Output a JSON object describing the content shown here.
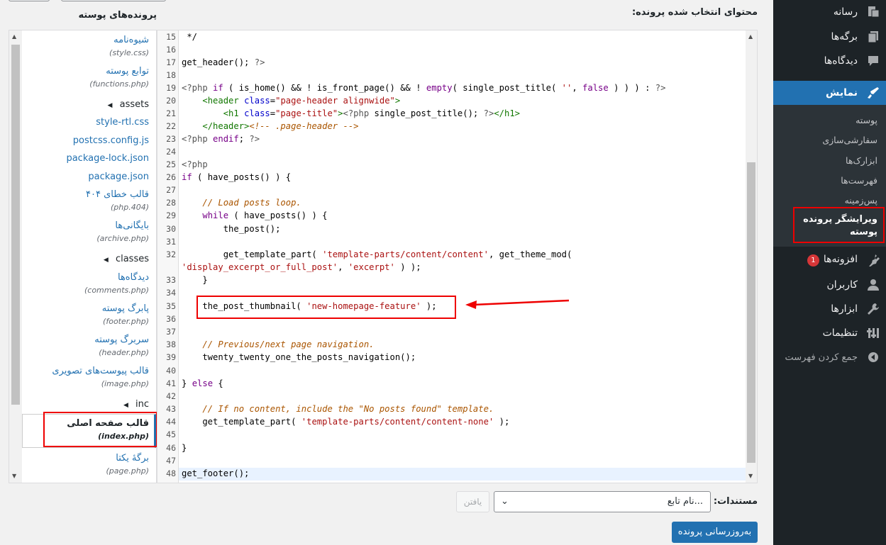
{
  "sidebar": {
    "items": [
      {
        "label": "رسانه",
        "icon": "media-icon"
      },
      {
        "label": "برگه‌ها",
        "icon": "pages-icon"
      },
      {
        "label": "دیدگاه‌ها",
        "icon": "comments-icon"
      },
      {
        "label": "نمایش",
        "icon": "appearance-icon"
      },
      {
        "label": "افزونه‌ها",
        "icon": "plugins-icon",
        "badge": "1"
      },
      {
        "label": "کاربران",
        "icon": "users-icon"
      },
      {
        "label": "ابزارها",
        "icon": "tools-icon"
      },
      {
        "label": "تنظیمات",
        "icon": "settings-icon"
      },
      {
        "label": "جمع کردن فهرست",
        "icon": "collapse-icon"
      }
    ],
    "submenu": [
      "پوسته",
      "سفارشی‌سازی",
      "ابزارک‌ها",
      "فهرست‌ها",
      "پس‌زمینه",
      "ویرایشگر پرونده پوسته"
    ]
  },
  "file_list": {
    "heading": "پرونده‌های پوسته",
    "entries": [
      {
        "name": "شیوه‌نامه",
        "path": "(style.css)"
      },
      {
        "name": "توابع پوسته",
        "path": "(functions.php)"
      },
      {
        "name": "assets"
      },
      {
        "name": "style-rtl.css"
      },
      {
        "name": "postcss.config.js"
      },
      {
        "name": "package-lock.json"
      },
      {
        "name": "package.json"
      },
      {
        "name": "قالب خطای ۴۰۴",
        "path": "(404.php)"
      },
      {
        "name": "بایگانی‌ها",
        "path": "(archive.php)"
      },
      {
        "name": "classes"
      },
      {
        "name": "دیدگاه‌ها",
        "path": "(comments.php)"
      },
      {
        "name": "پابرگ پوسته",
        "path": "(footer.php)"
      },
      {
        "name": "سربرگ پوسته",
        "path": "(header.php)"
      },
      {
        "name": "قالب پیوست‌های تصویری",
        "path": "(image.php)"
      },
      {
        "name": "inc"
      },
      {
        "name": "قالب صفحه اصلی",
        "path": "(index.php)"
      },
      {
        "name": "برگهٔ یکتا",
        "path": "(page.php)"
      }
    ]
  },
  "editor": {
    "heading": "محتوای انتخاب شده پرونده:",
    "line_numbers": [
      "15",
      "16",
      "17",
      "18",
      "19",
      "20",
      "21",
      "22",
      "23",
      "24",
      "25",
      "26",
      "27",
      "28",
      "29",
      "30",
      "31",
      "32",
      "",
      "33",
      "34",
      "35",
      "36",
      "37",
      "38",
      "39",
      "40",
      "41",
      "42",
      "43",
      "44",
      "45",
      "46",
      "47",
      "48"
    ]
  },
  "documentation": {
    "label": "مستندات:",
    "select_value": "...نام تابع",
    "lookup_label": "یافتن"
  },
  "update_button": "به‌روزرسانی پرونده",
  "colors": {
    "accent": "#2271b1",
    "sidebar_bg": "#1d2327",
    "highlight": "#ee0000"
  }
}
